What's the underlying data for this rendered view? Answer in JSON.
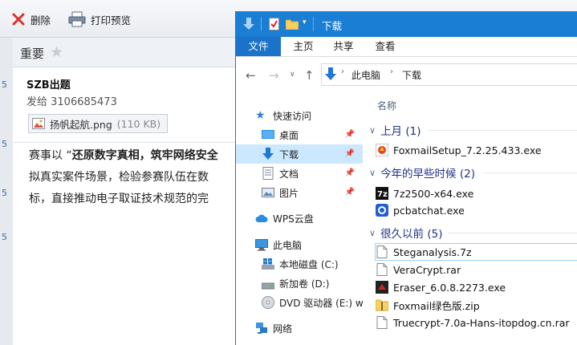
{
  "mail": {
    "toolbar": {
      "delete_label": "删除",
      "print_preview_label": "打印预览"
    },
    "left_strip_digits": [
      "5",
      "5",
      "5",
      "5"
    ],
    "importance_label": "重要",
    "subject": "SZB出题",
    "sender": "发给 3106685473",
    "attachment": {
      "name": "扬帆起航.png",
      "size": "(110 KB)"
    },
    "body": {
      "line1_prefix": "赛事以 “",
      "line1_bold": "还原数字真相，筑牢网络安全",
      "line2": "拟真实案件场景，检验参赛队伍在数",
      "line3": "标，直接推动电子取证技术规范的完"
    }
  },
  "explorer": {
    "title": "下载",
    "ribbon_tabs": [
      "文件",
      "主页",
      "共享",
      "查看"
    ],
    "breadcrumb": [
      "此电脑",
      "下载"
    ],
    "nav": {
      "quick_access": "快速访问",
      "desktop": "桌面",
      "downloads": "下载",
      "documents": "文档",
      "pictures": "图片",
      "wps_cloud": "WPS云盘",
      "this_pc": "此电脑",
      "local_disk": "本地磁盘 (C:)",
      "new_volume": "新加卷 (D:)",
      "dvd_drive": "DVD 驱动器 (E:) wi",
      "network": "网络"
    },
    "column_header": "名称",
    "groups": [
      {
        "label": "上月 (1)",
        "files": [
          "FoxmailSetup_7.2.25.433.exe"
        ]
      },
      {
        "label": "今年的早些时候 (2)",
        "files": [
          "7z2500-x64.exe",
          "pcbatchat.exe"
        ]
      },
      {
        "label": "很久以前 (5)",
        "files": [
          "Steganalysis.7z",
          "VeraCrypt.rar",
          "Eraser_6.0.8.2273.exe",
          "Foxmail绿色版.zip",
          "Truecrypt-7.0a-Hans-itopdog.cn.rar"
        ]
      }
    ]
  },
  "colors": {
    "titlebar": "#1a7fd4",
    "file_tab": "#1a73c8",
    "selection": "#cce8ff",
    "group_text": "#1e3287"
  }
}
